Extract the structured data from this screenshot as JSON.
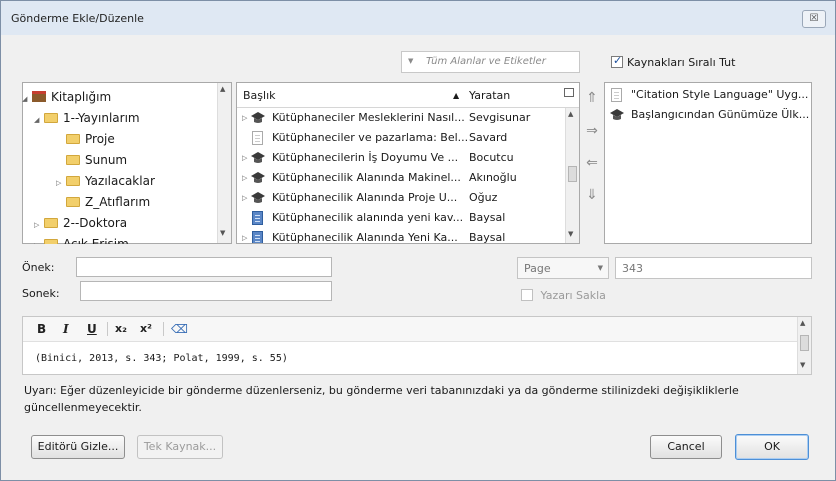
{
  "window": {
    "title": "Gönderme Ekle/Düzenle",
    "close_label": "☒"
  },
  "search": {
    "placeholder": "Tüm Alanlar ve Etiketler"
  },
  "keep_sorted": {
    "label": "Kaynakları Sıralı Tut",
    "checked": true
  },
  "tree": {
    "items": [
      {
        "label": "Kitaplığım",
        "icon": "library-icon",
        "level": 0,
        "expanded": true
      },
      {
        "label": "1--Yayınlarım",
        "icon": "folder-icon",
        "level": 1,
        "expanded": true
      },
      {
        "label": "Proje",
        "icon": "folder-icon",
        "level": 2
      },
      {
        "label": "Sunum",
        "icon": "folder-icon",
        "level": 2
      },
      {
        "label": "Yazılacaklar",
        "icon": "folder-icon",
        "level": 2,
        "collapsed": true
      },
      {
        "label": "Z_Atıflarım",
        "icon": "folder-icon",
        "level": 2
      },
      {
        "label": "2--Doktora",
        "icon": "folder-icon",
        "level": 1,
        "collapsed": true
      },
      {
        "label": "Açık Erişim",
        "icon": "folder-icon",
        "level": 1,
        "collapsed": true
      }
    ]
  },
  "items_list": {
    "headers": {
      "title": "Başlık",
      "creator": "Yaratan"
    },
    "rows": [
      {
        "icon": "cap",
        "title": "Kütüphaneciler Mesleklerini Nasıl...",
        "creator": "Sevgisunar",
        "expand": true
      },
      {
        "icon": "doc",
        "title": "Kütüphaneciler ve pazarlama: Bel...",
        "creator": "Savard",
        "expand": false
      },
      {
        "icon": "cap",
        "title": "Kütüphanecilerin İş Doyumu Ve ...",
        "creator": "Bocutcu",
        "expand": true
      },
      {
        "icon": "cap",
        "title": "Kütüphanecilik Alanında Makinel...",
        "creator": "Akınoğlu",
        "expand": true
      },
      {
        "icon": "cap",
        "title": "Kütüphanecilik Alanında Proje U...",
        "creator": "Oğuz",
        "expand": true
      },
      {
        "icon": "book",
        "title": "Kütüphanecilik alanında yeni kav...",
        "creator": "Baysal",
        "expand": false
      },
      {
        "icon": "book",
        "title": "Kütüphanecilik Alanında Yeni Ka...",
        "creator": "Baysal",
        "expand": true
      }
    ]
  },
  "selected_citations": [
    {
      "icon": "doc",
      "label": "\"Citation Style Language\" Uyg..."
    },
    {
      "icon": "cap",
      "label": "Başlangıcından Günümüze Ülk..."
    }
  ],
  "transfer_arrows": [
    "⇑",
    "⇒",
    "⇐",
    "⇓"
  ],
  "fields": {
    "prefix_label": "Önek:",
    "prefix_value": "",
    "suffix_label": "Sonek:",
    "suffix_value": "",
    "locator_type": "Page",
    "locator_value": "343",
    "suppress_author_label": "Yazarı Sakla"
  },
  "editor": {
    "toolbar": {
      "bold": "B",
      "italic": "I",
      "underline": "U",
      "subscript": "x₂",
      "superscript": "x²",
      "clear": "⌫"
    },
    "text": "(Binici, 2013, s. 343; Polat, 1999, s. 55)"
  },
  "warning": "Uyarı: Eğer düzenleyicide bir gönderme düzenlerseniz, bu gönderme veri tabanınızdaki ya da gönderme stilinizdeki değişikliklerle güncellenmeyecektir.",
  "buttons": {
    "hide_editor": "Editörü Gizle...",
    "single_source": "Tek Kaynak...",
    "cancel": "Cancel",
    "ok": "OK"
  }
}
